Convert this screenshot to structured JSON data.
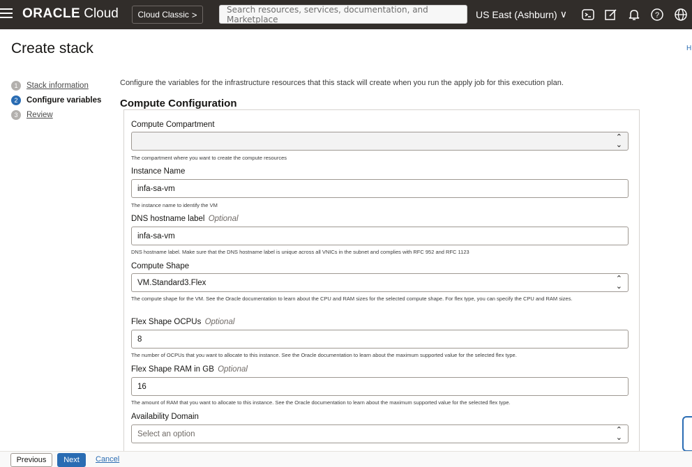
{
  "header": {
    "logo_oracle": "ORACLE",
    "logo_cloud": "Cloud",
    "classic_label": "Cloud Classic",
    "classic_chevron": ">",
    "search_placeholder": "Search resources, services, documentation, and Marketplace",
    "region": "US East (Ashburn)",
    "region_chevron": "∨"
  },
  "page": {
    "title": "Create stack",
    "help": "H"
  },
  "steps": [
    {
      "num": "1",
      "label": "Stack information",
      "active": false
    },
    {
      "num": "2",
      "label": "Configure variables",
      "active": true
    },
    {
      "num": "3",
      "label": "Review",
      "active": false
    }
  ],
  "main": {
    "intro": "Configure the variables for the infrastructure resources that this stack will create when you run the apply job for this execution plan.",
    "section_title": "Compute Configuration",
    "fields": {
      "compartment": {
        "label": "Compute Compartment",
        "value": "",
        "help": "The compartment where you want to create the compute resources"
      },
      "instance_name": {
        "label": "Instance Name",
        "value": "infa-sa-vm",
        "help": "The instance name to identify the VM"
      },
      "dns_label": {
        "label": "DNS hostname label",
        "optional": "Optional",
        "value": "infa-sa-vm",
        "help": "DNS hostname label. Make sure that the DNS hostname label is unique across all VNICs in the subnet and complies with RFC 952 and RFC 1123"
      },
      "shape": {
        "label": "Compute Shape",
        "value": "VM.Standard3.Flex",
        "help": "The compute shape for the VM. See the Oracle documentation to learn about the CPU and RAM sizes for the selected compute shape. For flex type, you can specify the CPU and RAM sizes."
      },
      "ocpus": {
        "label": "Flex Shape OCPUs",
        "optional": "Optional",
        "value": "8",
        "help": "The number of OCPUs that you want to allocate to this instance. See the Oracle documentation to learn about the maximum supported value for the selected flex type."
      },
      "ram": {
        "label": "Flex Shape RAM in GB",
        "optional": "Optional",
        "value": "16",
        "help": "The amount of RAM that you want to allocate to this instance. See the Oracle documentation to learn about the maximum supported value for the selected flex type."
      },
      "ad": {
        "label": "Availability Domain",
        "placeholder": "Select an option"
      }
    }
  },
  "footer": {
    "previous": "Previous",
    "next": "Next",
    "cancel": "Cancel"
  },
  "colors": {
    "topbar": "#312d2a",
    "accent": "#2a6cb3"
  },
  "icons": [
    "hamburger-icon",
    "cloud-shell-icon",
    "edit-icon",
    "notifications-icon",
    "help-icon",
    "language-icon",
    "updown-icon"
  ]
}
